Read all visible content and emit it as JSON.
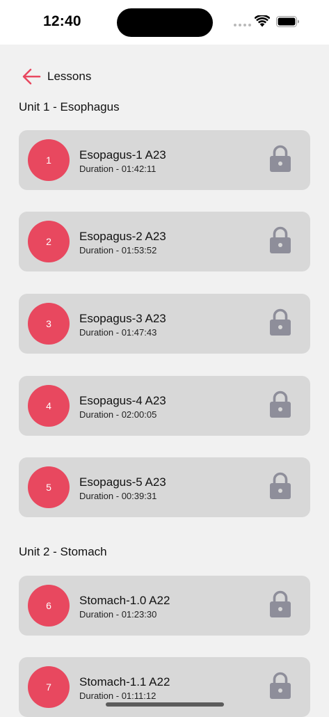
{
  "status_bar": {
    "time": "12:40"
  },
  "nav": {
    "title": "Lessons",
    "back_icon": "arrow-left-icon"
  },
  "colors": {
    "accent": "#e8485f",
    "card": "#d8d8d8",
    "lock": "#8e8e9a",
    "background": "#f1f1f1"
  },
  "units": [
    {
      "title": "Unit 1 - Esophagus",
      "lessons": [
        {
          "number": "1",
          "title": "Esopagus-1 A23",
          "duration": "Duration - 01:42:11",
          "icon": "lock-icon"
        },
        {
          "number": "2",
          "title": "Esopagus-2 A23",
          "duration": "Duration - 01:53:52",
          "icon": "lock-icon"
        },
        {
          "number": "3",
          "title": "Esopagus-3 A23",
          "duration": "Duration - 01:47:43",
          "icon": "lock-icon"
        },
        {
          "number": "4",
          "title": "Esopagus-4 A23",
          "duration": "Duration - 02:00:05",
          "icon": "lock-icon"
        },
        {
          "number": "5",
          "title": "Esopagus-5 A23",
          "duration": "Duration - 00:39:31",
          "icon": "lock-icon"
        }
      ]
    },
    {
      "title": "Unit 2 - Stomach",
      "lessons": [
        {
          "number": "6",
          "title": "Stomach-1.0 A22",
          "duration": "Duration - 01:23:30",
          "icon": "lock-icon"
        },
        {
          "number": "7",
          "title": "Stomach-1.1 A22",
          "duration": "Duration - 01:11:12",
          "icon": "lock-icon"
        }
      ]
    }
  ]
}
